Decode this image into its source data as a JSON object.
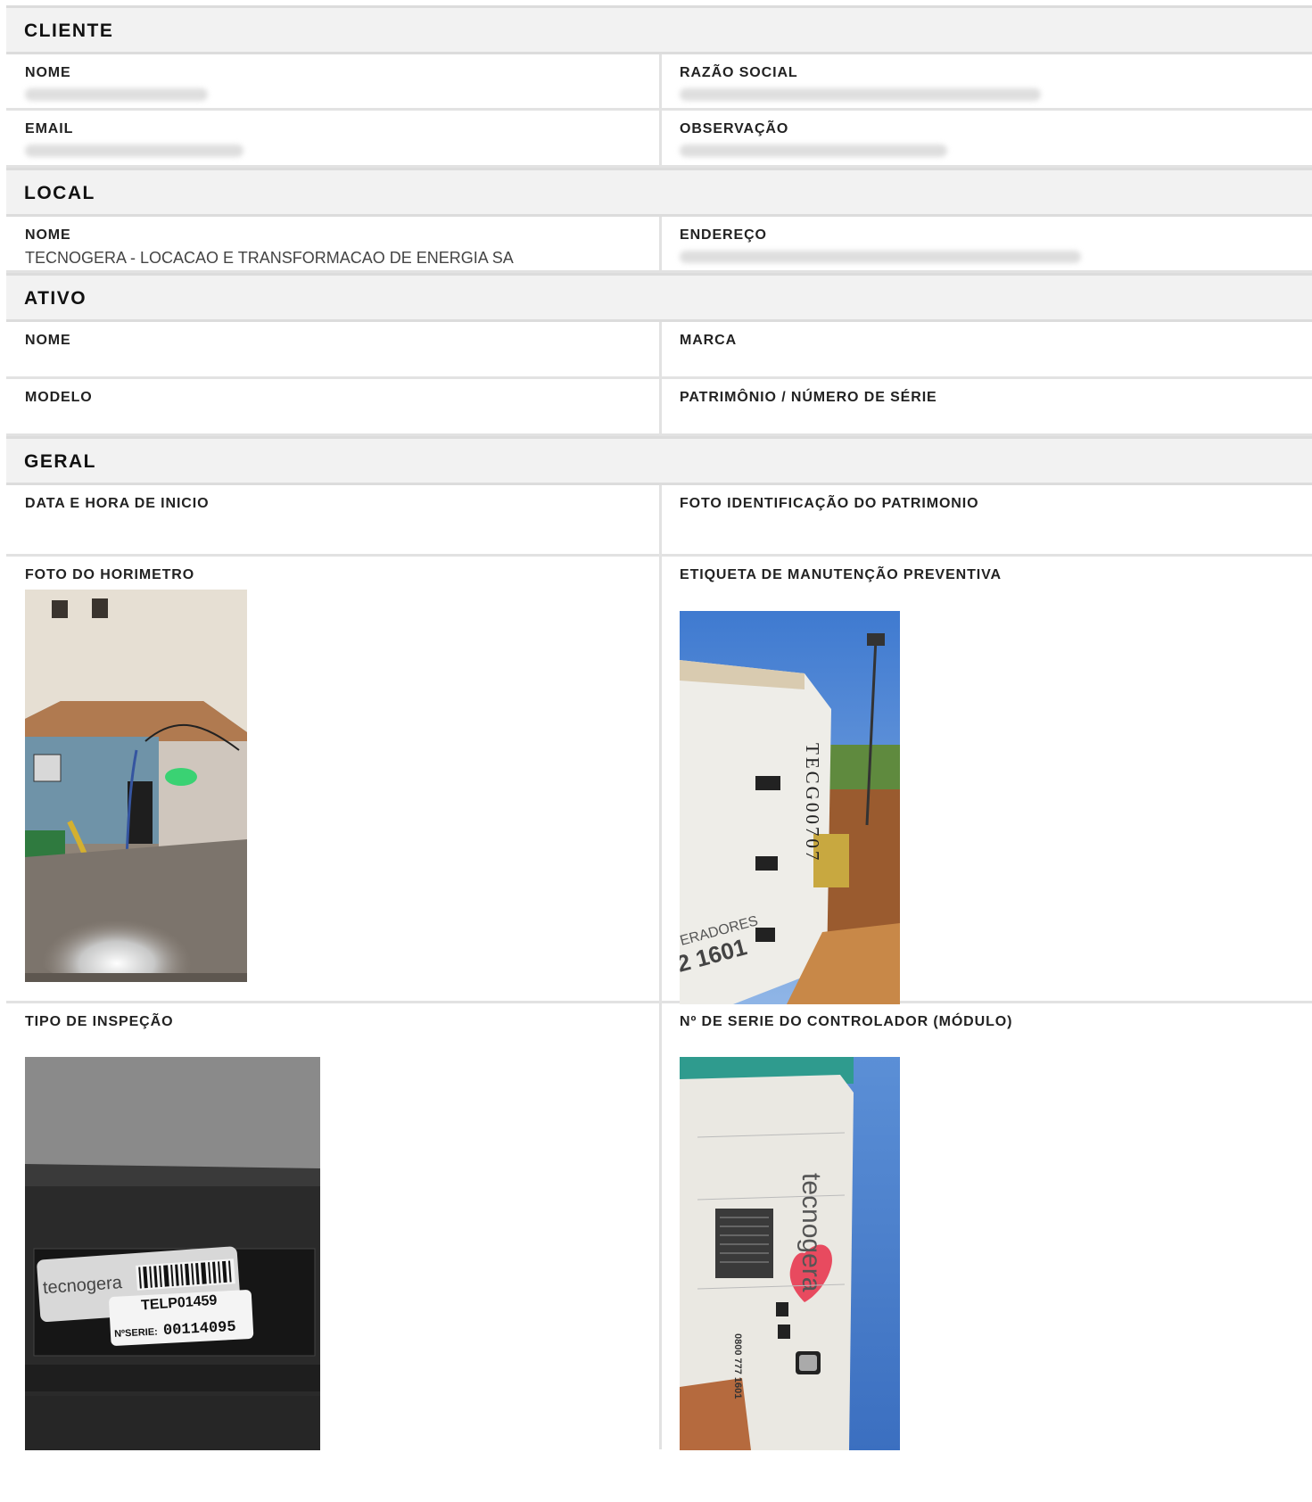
{
  "cliente": {
    "title": "CLIENTE",
    "nome_label": "NOME",
    "razao_label": "RAZÃO SOCIAL",
    "email_label": "EMAIL",
    "obs_label": "OBSERVAÇÃO"
  },
  "local": {
    "title": "LOCAL",
    "nome_label": "NOME",
    "nome_value": "TECNOGERA - LOCACAO E TRANSFORMACAO DE ENERGIA SA",
    "endereco_label": "ENDEREÇO"
  },
  "ativo": {
    "title": "ATIVO",
    "nome_label": "NOME",
    "marca_label": "MARCA",
    "modelo_label": "MODELO",
    "patrimonio_label": "PATRIMÔNIO / NÚMERO DE SÉRIE"
  },
  "geral": {
    "title": "GERAL",
    "data_label": "DATA E HORA DE INICIO",
    "foto_id_label": "FOTO IDENTIFICAÇÃO DO PATRIMONIO",
    "horimetro_label": "FOTO DO HORIMETRO",
    "etiqueta_label": "ETIQUETA DE MANUTENÇÃO PREVENTIVA",
    "tipo_label": "TIPO DE INSPEÇÃO",
    "serie_label": "Nº DE SERIE DO CONTROLADOR (MÓDULO)"
  },
  "photos": {
    "etiqueta_text": "TECG00707",
    "etiqueta_side": "ERADORES",
    "etiqueta_phone": "2 1601",
    "tipo_brand": "tecnogera",
    "tipo_code": "TELP01459",
    "tipo_serie_prefix": "NºSERIE:",
    "tipo_serie_number": "00114095",
    "serie_brand": "tecnogera",
    "serie_phone": "0800 777 1601"
  }
}
